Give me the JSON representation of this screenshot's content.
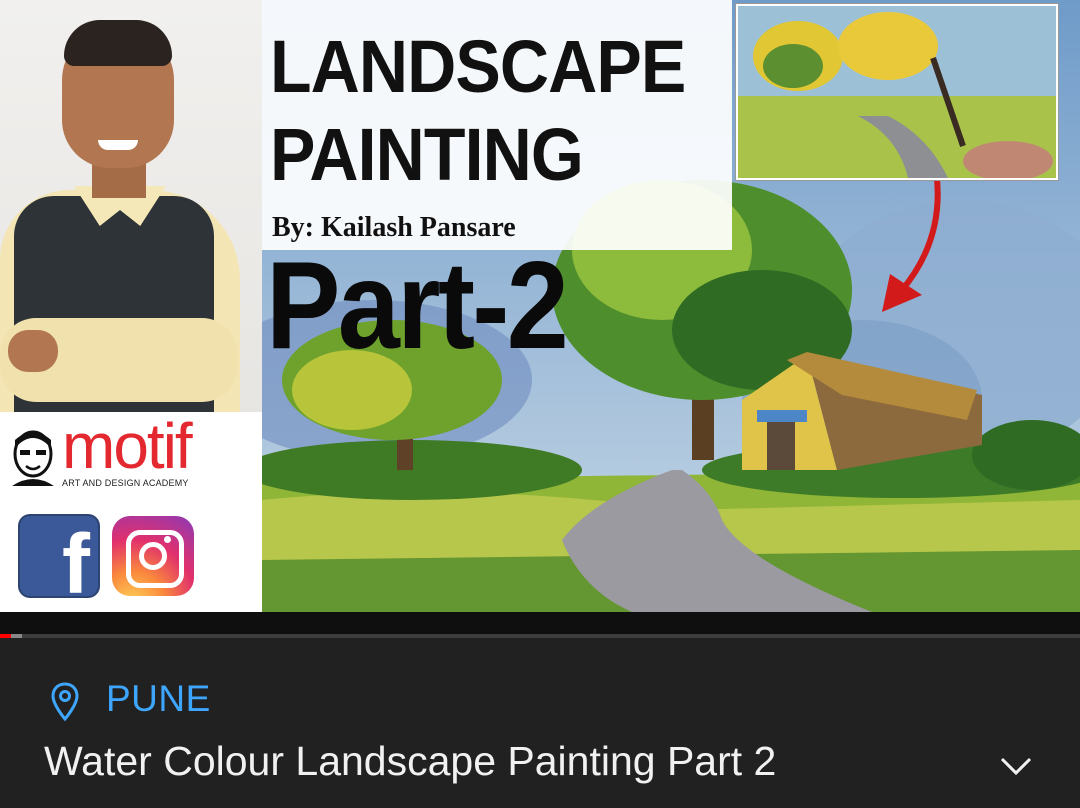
{
  "thumbnail": {
    "title_line1": "LANDSCAPE",
    "title_line2": "PAINTING",
    "byline": "By: Kailash Pansare",
    "part": "Part-2",
    "logo_text": "motif",
    "logo_subtitle": "ART AND DESIGN ACADEMY",
    "social_icons": [
      "facebook-icon",
      "instagram-icon"
    ]
  },
  "player": {
    "progress_fraction": 0.01,
    "buffered_fraction": 0.02
  },
  "video": {
    "location": "PUNE",
    "title": "Water Colour Landscape Painting Part 2"
  },
  "colors": {
    "accent": "#3ea6ff",
    "progress": "#ff0000",
    "background": "#212121",
    "logo": "#e3292f"
  }
}
